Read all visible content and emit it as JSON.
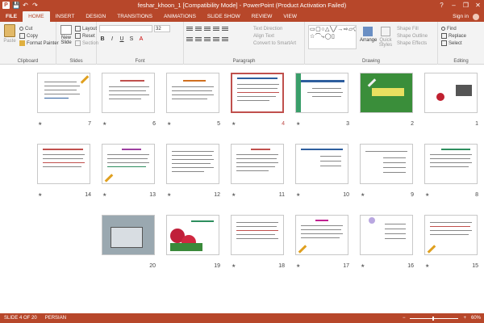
{
  "window": {
    "title": "feshar_khoon_1 [Compatibility Mode] - PowerPoint (Product Activation Failed)",
    "help": "?",
    "minimize": "–",
    "restore": "❐",
    "close": "✕"
  },
  "qat": {
    "logo": "P",
    "save": "💾",
    "undo": "↶",
    "redo": "↷"
  },
  "tabs": [
    "FILE",
    "HOME",
    "INSERT",
    "DESIGN",
    "TRANSITIONS",
    "ANIMATIONS",
    "SLIDE SHOW",
    "REVIEW",
    "VIEW"
  ],
  "active_tab": "HOME",
  "signin": "Sign in",
  "ribbon": {
    "clipboard": {
      "paste": "Paste",
      "cut": "Cut",
      "copy": "Copy",
      "format_painter": "Format Painter",
      "label": "Clipboard"
    },
    "slides": {
      "new_slide": "New Slide",
      "layout": "Layout",
      "reset": "Reset",
      "section": "Section",
      "label": "Slides"
    },
    "font": {
      "size": "32",
      "label": "Font"
    },
    "paragraph": {
      "text_direction": "Text Direction",
      "align_text": "Align Text",
      "convert_smartart": "Convert to SmartArt",
      "label": "Paragraph"
    },
    "drawing": {
      "arrange": "Arrange",
      "quick_styles": "Quick Styles",
      "shape_fill": "Shape Fill",
      "shape_outline": "Shape Outline",
      "shape_effects": "Shape Effects",
      "label": "Drawing"
    },
    "editing": {
      "find": "Find",
      "replace": "Replace",
      "select": "Select",
      "label": "Editing"
    }
  },
  "slides": [
    {
      "num": "1"
    },
    {
      "num": "2"
    },
    {
      "num": "3"
    },
    {
      "num": "4"
    },
    {
      "num": "5"
    },
    {
      "num": "6"
    },
    {
      "num": "7"
    },
    {
      "num": "8"
    },
    {
      "num": "9"
    },
    {
      "num": "10"
    },
    {
      "num": "11"
    },
    {
      "num": "12"
    },
    {
      "num": "13"
    },
    {
      "num": "14"
    },
    {
      "num": "15"
    },
    {
      "num": "16"
    },
    {
      "num": "17"
    },
    {
      "num": "18"
    },
    {
      "num": "19"
    },
    {
      "num": "20"
    }
  ],
  "selected_slide": "4",
  "status": {
    "slide_info": "SLIDE 4 OF 20",
    "language": "PERSIAN",
    "zoom": "60%"
  },
  "colors": {
    "accent": "#b7472a",
    "selection": "#c0504d"
  }
}
